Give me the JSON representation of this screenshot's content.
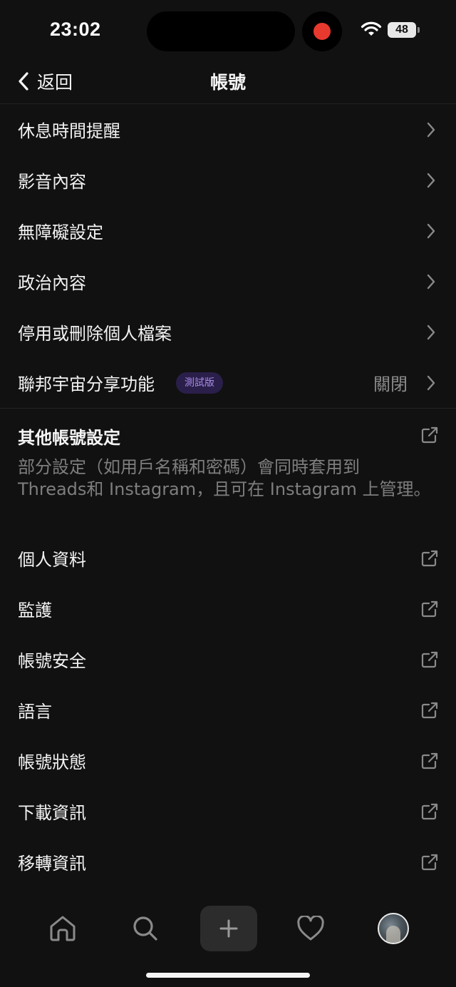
{
  "status_bar": {
    "time": "23:02",
    "battery": "48"
  },
  "header": {
    "back_label": "返回",
    "title": "帳號"
  },
  "settings_items": [
    {
      "label": "休息時間提醒"
    },
    {
      "label": "影音內容"
    },
    {
      "label": "無障礙設定"
    },
    {
      "label": "政治內容"
    },
    {
      "label": "停用或刪除個人檔案"
    },
    {
      "label": "聯邦宇宙分享功能",
      "badge": "測試版",
      "value": "關閉"
    }
  ],
  "other_section": {
    "title": "其他帳號設定",
    "description": "部分設定（如用戶名稱和密碼）會同時套用到 Threads和 Instagram，且可在 Instagram 上管理。"
  },
  "external_items": [
    {
      "label": "個人資料"
    },
    {
      "label": "監護"
    },
    {
      "label": "帳號安全"
    },
    {
      "label": "語言"
    },
    {
      "label": "帳號狀態"
    },
    {
      "label": "下載資訊"
    },
    {
      "label": "移轉資訊"
    }
  ],
  "tab_bar": {
    "tabs": [
      "home-icon",
      "search-icon",
      "plus-icon",
      "heart-icon",
      "avatar"
    ]
  },
  "colors": {
    "background": "#111111",
    "badge_bg": "#2a1f4a",
    "badge_text": "#a98be6",
    "recording": "#e8392f"
  }
}
